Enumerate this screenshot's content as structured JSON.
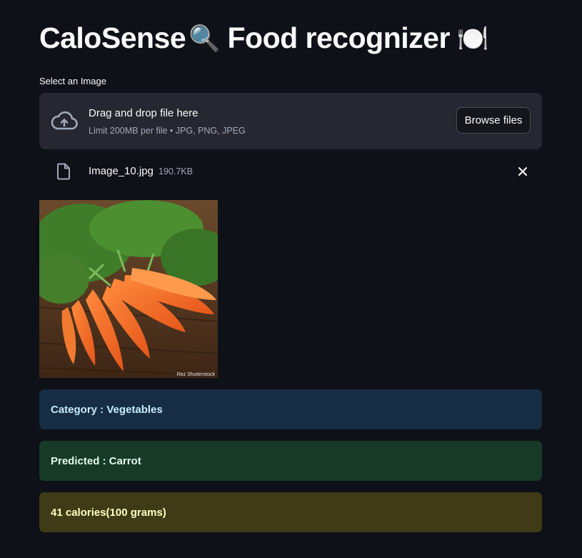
{
  "app": {
    "title": "CaloSense",
    "title_search_emoji": "🔍",
    "title_rest": "Food recognizer",
    "title_plate_emoji": "🍽️"
  },
  "uploader": {
    "label": "Select an Image",
    "drop_text": "Drag and drop file here",
    "limit_text": "Limit 200MB per file • JPG, PNG, JPEG",
    "browse_label": "Browse files",
    "icon": "cloud-upload-icon"
  },
  "file": {
    "name": "Image_10.jpg",
    "size": "190.7KB",
    "icon": "file-icon",
    "remove_icon": "close-icon"
  },
  "image": {
    "watermark": "Rez Shutterstock"
  },
  "results": {
    "category": "Category : Vegetables",
    "predicted": "Predicted : Carrot",
    "calories": "41 calories(100 grams)"
  },
  "colors": {
    "background": "#0e1117",
    "info": "#172d43",
    "success": "#173928",
    "warning": "#3e3b16"
  }
}
